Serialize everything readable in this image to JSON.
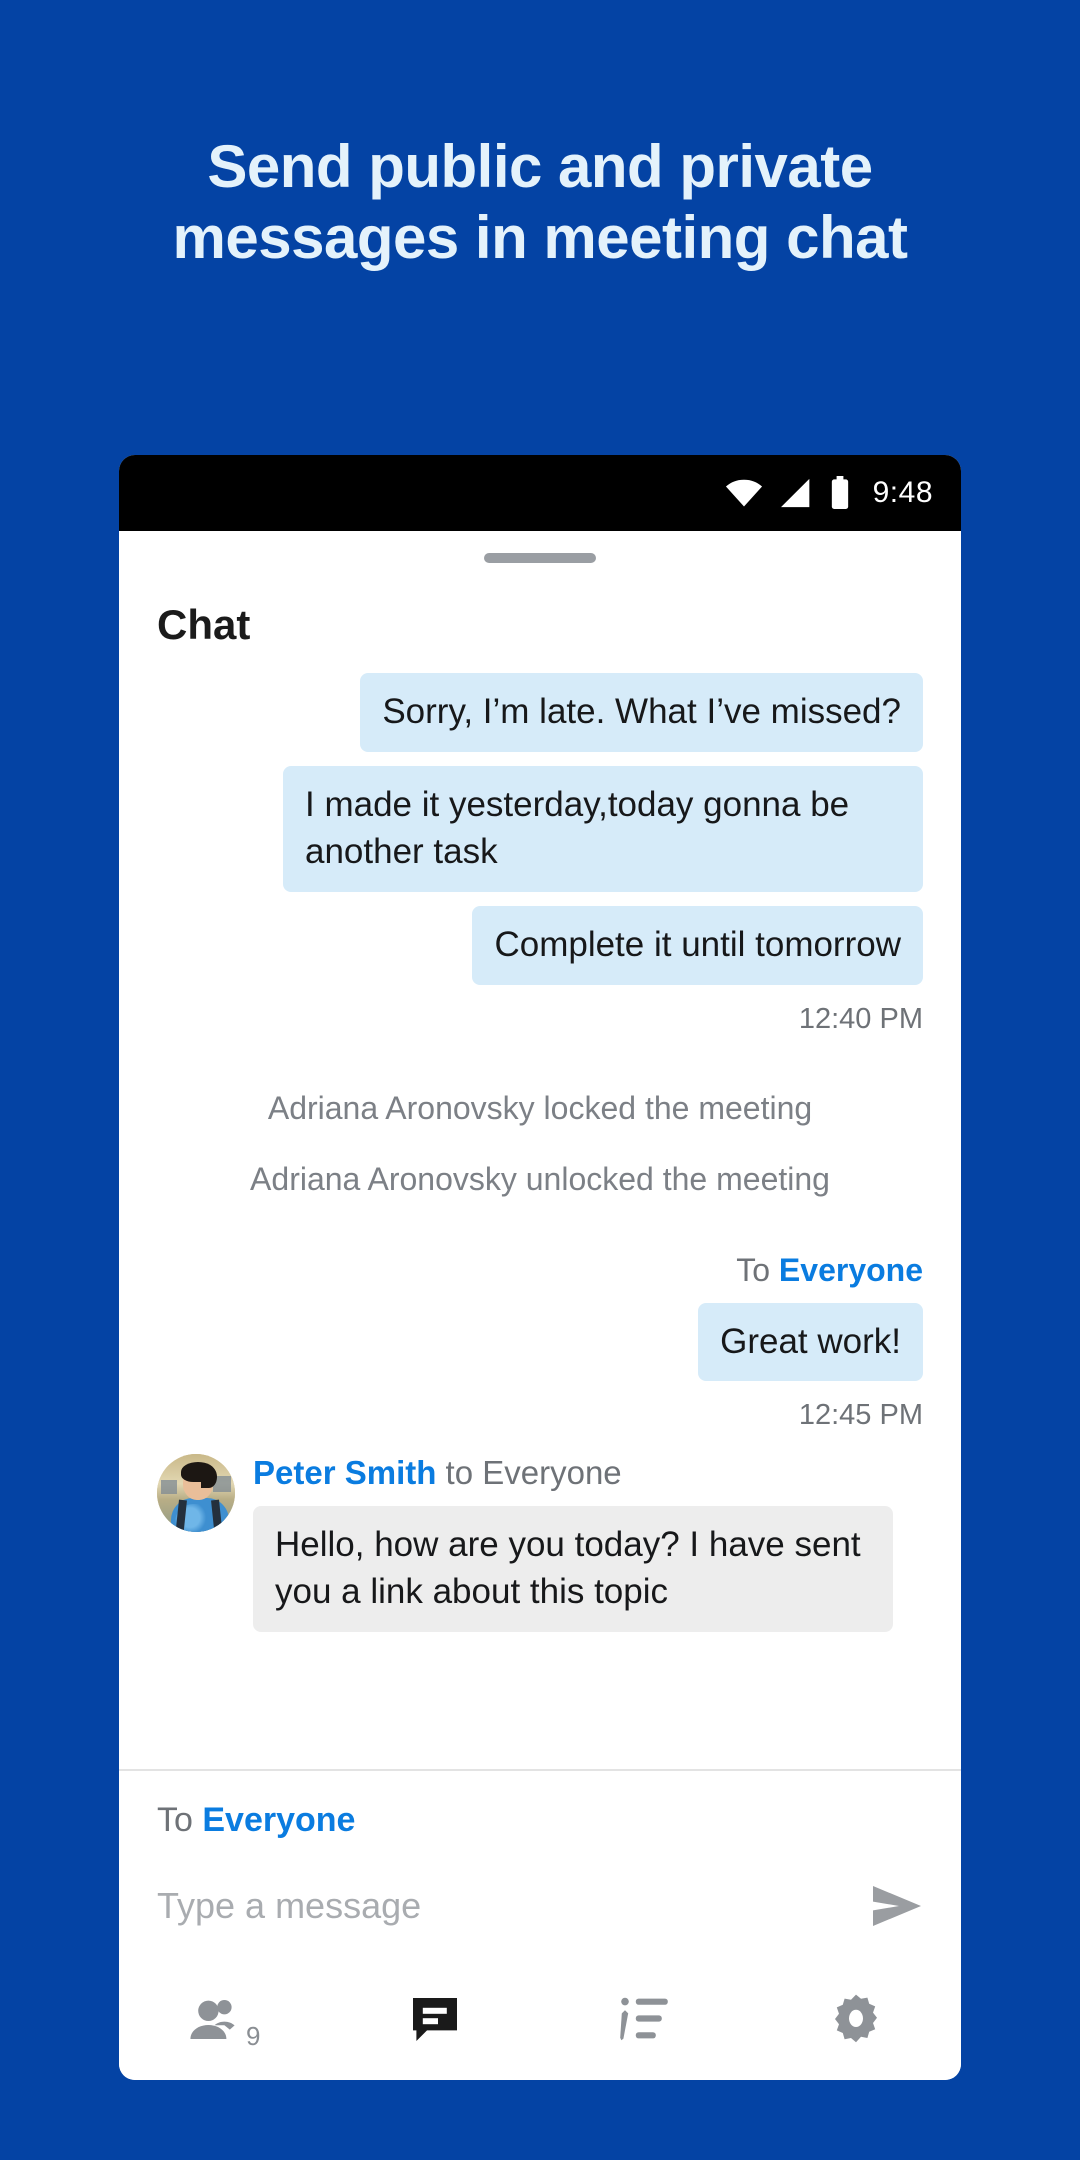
{
  "promo": {
    "headline": "Send public and private messages in meeting chat",
    "background_color": "#0443A4",
    "headline_color": "#E4F2FB"
  },
  "statusbar": {
    "time": "9:48",
    "icons": [
      "wifi-icon",
      "cell-signal-icon",
      "battery-icon"
    ]
  },
  "panel": {
    "title": "Chat",
    "accent_color": "#0A7CE0",
    "own_bubble_color": "#D6EBF9",
    "other_bubble_color": "#EDEDED"
  },
  "messages": [
    {
      "kind": "own",
      "text": "Sorry, I’m late. What I’ve missed?"
    },
    {
      "kind": "own",
      "text": "I made it yesterday,today gonna be another task"
    },
    {
      "kind": "own",
      "text": "Complete it until tomorrow"
    },
    {
      "kind": "timestamp",
      "text": "12:40 PM"
    },
    {
      "kind": "system",
      "text": "Adriana Aronovsky locked the meeting"
    },
    {
      "kind": "system",
      "text": "Adriana Aronovsky unlocked the meeting"
    },
    {
      "kind": "to_label",
      "prefix": "To ",
      "target": "Everyone"
    },
    {
      "kind": "own",
      "text": "Great work!"
    },
    {
      "kind": "timestamp",
      "text": "12:45 PM"
    },
    {
      "kind": "incoming",
      "sender": "Peter Smith",
      "to": " to Everyone",
      "text": "Hello, how are you today? I have sent you a link about this topic",
      "avatar": "person-photo-avatar"
    }
  ],
  "composer": {
    "to_prefix": "To ",
    "to_target": "Everyone",
    "placeholder": "Type a message",
    "value": "",
    "send_icon": "send-icon"
  },
  "toolbar": {
    "items": [
      {
        "name": "participants",
        "icon": "people-icon",
        "badge": "9",
        "active": false
      },
      {
        "name": "chat",
        "icon": "chat-bubble-icon",
        "badge": "",
        "active": true
      },
      {
        "name": "polls",
        "icon": "poll-list-icon",
        "badge": "",
        "active": false
      },
      {
        "name": "settings",
        "icon": "gear-icon",
        "badge": "",
        "active": false
      }
    ]
  }
}
